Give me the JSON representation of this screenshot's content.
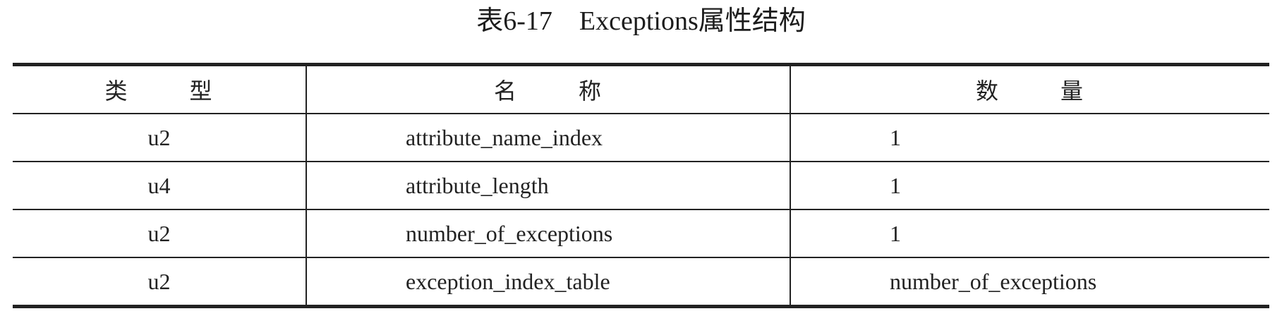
{
  "caption": "表6-17　Exceptions属性结构",
  "table": {
    "headers": [
      [
        "类",
        "型"
      ],
      [
        "名",
        "称"
      ],
      [
        "数",
        "量"
      ]
    ],
    "rows": [
      {
        "type": "u2",
        "name": "attribute_name_index",
        "count": "1"
      },
      {
        "type": "u4",
        "name": "attribute_length",
        "count": "1"
      },
      {
        "type": "u2",
        "name": "number_of_exceptions",
        "count": "1"
      },
      {
        "type": "u2",
        "name": "exception_index_table",
        "count": "number_of_exceptions"
      }
    ]
  }
}
